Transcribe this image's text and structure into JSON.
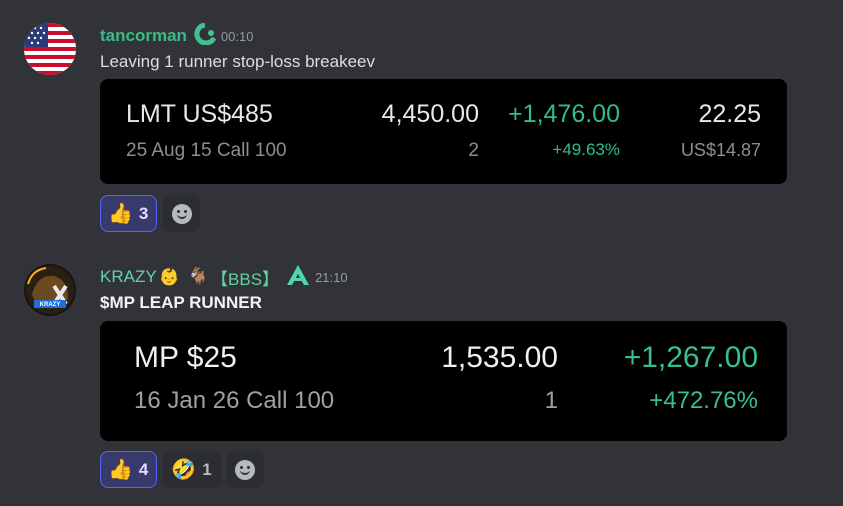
{
  "messages": [
    {
      "username": "tancorman",
      "timestamp": "00:10",
      "content": "Leaving 1 runner stop-loss breakeev",
      "card": {
        "symbol": "LMT US$485",
        "contract": "25 Aug 15 Call 100",
        "price": "4,450.00",
        "quantity": "2",
        "pl": "+1,476.00",
        "pl_pct": "+49.63%",
        "last": "22.25",
        "avg": "US$14.87"
      },
      "reactions": [
        {
          "emoji": "👍",
          "count": "3"
        }
      ]
    },
    {
      "username": "KRAZY",
      "user_emojis": [
        "👶",
        "🐐"
      ],
      "tag": "【BBS】",
      "timestamp": "21:10",
      "content": "$MP LEAP RUNNER",
      "card": {
        "symbol": "MP $25",
        "contract": "16 Jan 26 Call 100",
        "price": "1,535.00",
        "quantity": "1",
        "pl": "+1,267.00",
        "pl_pct": "+472.76%"
      },
      "reactions": [
        {
          "emoji": "👍",
          "count": "4"
        },
        {
          "emoji": "🤣",
          "count": "1"
        }
      ]
    }
  ],
  "colors": {
    "background": "#313338",
    "username_green": "#3fb989",
    "profit_green": "#2fbf85",
    "reaction_active": "#373a6b"
  },
  "icons": [
    "us-flag-avatar",
    "krazy-avatar",
    "guild-badge-icon",
    "server-badge-icon",
    "add-reaction-icon"
  ]
}
